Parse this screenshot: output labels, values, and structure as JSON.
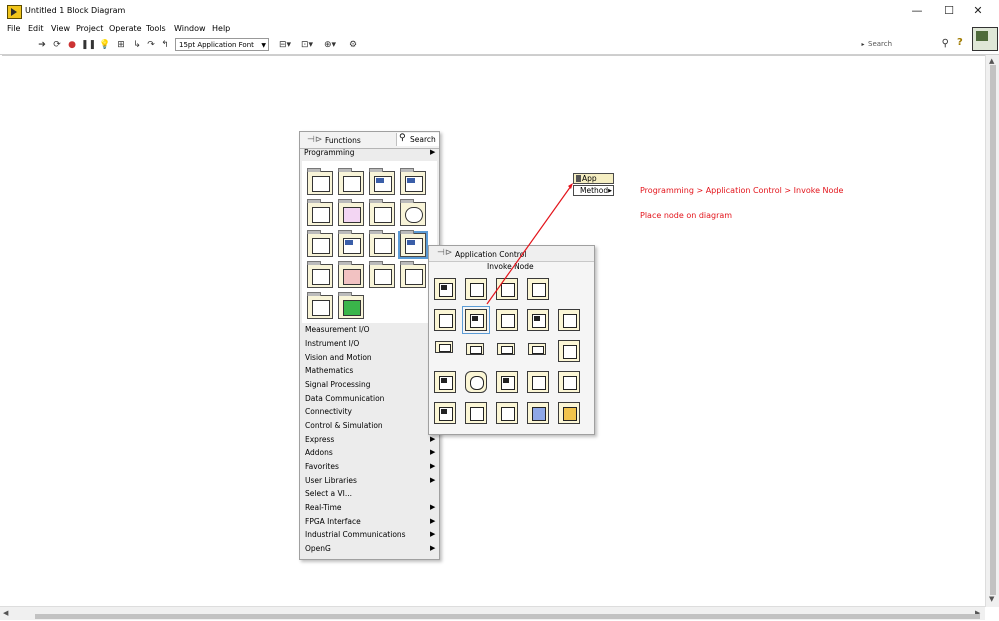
{
  "window": {
    "title": "Untitled 1 Block Diagram",
    "minimize": "—",
    "maximize": "☐",
    "close": "✕"
  },
  "menu": [
    "File",
    "Edit",
    "View",
    "Project",
    "Operate",
    "Tools",
    "Window",
    "Help"
  ],
  "toolbar": {
    "font": "15pt Application Font",
    "search_placeholder": "Search",
    "help": "?"
  },
  "palette": {
    "title": "Functions",
    "search": "Search",
    "current": "Programming",
    "categories": [
      "Measurement I/O",
      "Instrument I/O",
      "Vision and Motion",
      "Mathematics",
      "Signal Processing",
      "Data Communication",
      "Connectivity",
      "Control & Simulation",
      "Express",
      "Addons",
      "Favorites",
      "User Libraries",
      "Select a VI...",
      "Real-Time",
      "FPGA Interface",
      "Industrial Communications",
      "OpenG"
    ]
  },
  "subpalette": {
    "title": "Application Control",
    "tooltip": "Invoke Node"
  },
  "node": {
    "class_label": "App",
    "method_label": "Method"
  },
  "notes": {
    "path": "Programming > Application Control > Invoke Node",
    "instruction": "Place node on diagram"
  },
  "colors": {
    "annotation": "#e3141b",
    "selection": "#5b9bd5"
  }
}
